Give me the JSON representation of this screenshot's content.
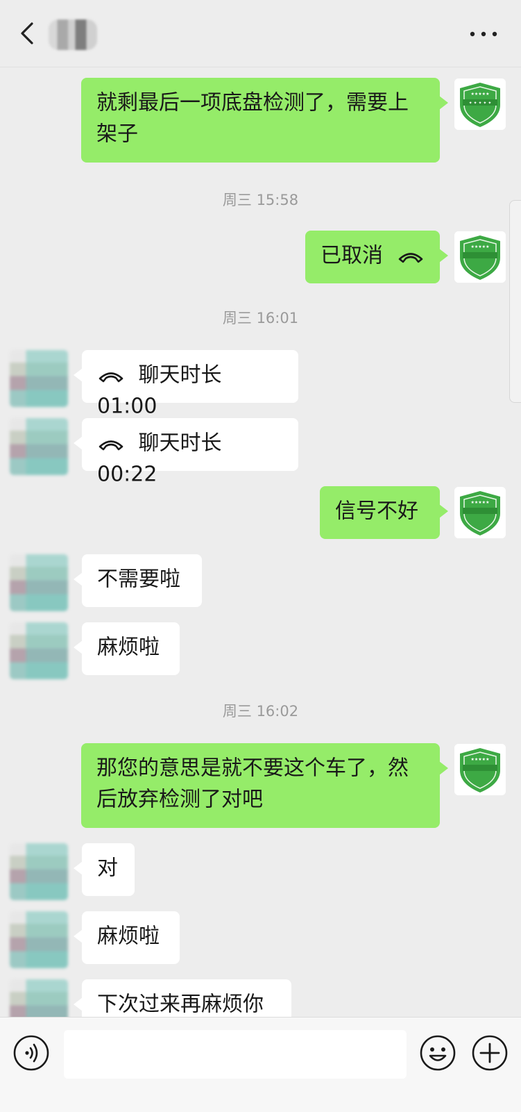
{
  "header": {
    "back_icon": "chevron-left-icon",
    "more_icon": "more-dots-icon"
  },
  "messages": [
    {
      "side": "me",
      "type": "text",
      "text": "就剩最后一项底盘检测了，需要上架子"
    },
    {
      "type": "time",
      "text": "周三 15:58"
    },
    {
      "side": "me",
      "type": "call",
      "text": "已取消",
      "icon": "phone-hangup-icon"
    },
    {
      "type": "time",
      "text": "周三 16:01"
    },
    {
      "side": "other",
      "type": "call",
      "text": "聊天时长 01:00",
      "icon": "phone-hangup-icon"
    },
    {
      "side": "other",
      "type": "call",
      "text": "聊天时长 00:22",
      "icon": "phone-hangup-icon"
    },
    {
      "side": "me",
      "type": "text",
      "text": "信号不好"
    },
    {
      "side": "other",
      "type": "text",
      "text": "不需要啦"
    },
    {
      "side": "other",
      "type": "text",
      "text": "麻烦啦"
    },
    {
      "type": "time",
      "text": "周三 16:02"
    },
    {
      "side": "me",
      "type": "text",
      "text": "那您的意思是就不要这个车了，然后放弃检测了对吧"
    },
    {
      "side": "other",
      "type": "text",
      "text": "对"
    },
    {
      "side": "other",
      "type": "text",
      "text": "麻烦啦"
    },
    {
      "side": "other",
      "type": "text",
      "text": "下次过来再麻烦你"
    }
  ],
  "input_bar": {
    "voice_icon": "voice-icon",
    "input_value": "",
    "emoji_icon": "emoji-icon",
    "plus_icon": "plus-circle-icon"
  },
  "colors": {
    "background": "#ededed",
    "my_bubble": "#95ec69",
    "other_bubble": "#ffffff",
    "timestamp": "#9a9a9a",
    "badge_green": "#3da944"
  }
}
